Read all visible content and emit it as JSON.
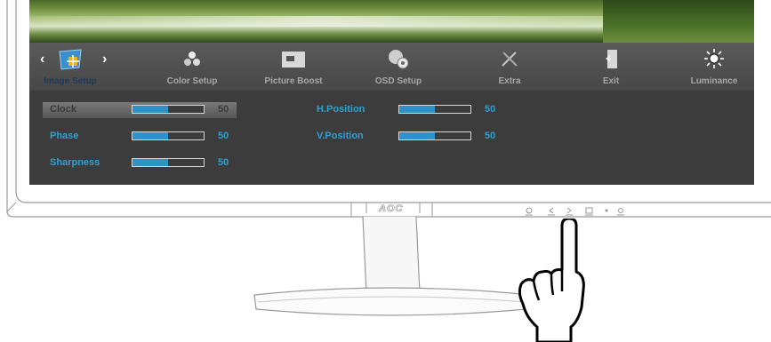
{
  "brand": "AOC",
  "menu": [
    {
      "label": "Image Setup",
      "icon": "image-setup-icon",
      "active": true
    },
    {
      "label": "Color Setup",
      "icon": "color-setup-icon",
      "active": false
    },
    {
      "label": "Picture Boost",
      "icon": "picture-boost-icon",
      "active": false
    },
    {
      "label": "OSD Setup",
      "icon": "osd-setup-icon",
      "active": false
    },
    {
      "label": "Extra",
      "icon": "extra-icon",
      "active": false
    },
    {
      "label": "Exit",
      "icon": "exit-icon",
      "active": false
    },
    {
      "label": "Luminance",
      "icon": "luminance-icon",
      "active": false
    }
  ],
  "settings_left": [
    {
      "name": "Clock",
      "value": "50",
      "level": 0.5,
      "selected": true
    },
    {
      "name": "Phase",
      "value": "50",
      "level": 0.5,
      "selected": false
    },
    {
      "name": "Sharpness",
      "value": "50",
      "level": 0.5,
      "selected": false
    }
  ],
  "settings_right": [
    {
      "name": "H.Position",
      "value": "50",
      "level": 0.5
    },
    {
      "name": "V.Position",
      "value": "50",
      "level": 0.5
    }
  ],
  "front_buttons": [
    "power-icon",
    "chevron-left-icon",
    "chevron-right-icon",
    "menu-icon",
    "dot-icon",
    "source-icon"
  ],
  "colors": {
    "accent": "#2fa0d2",
    "bar_fill": "#2c93c8",
    "osd_bg": "#3c3c3c"
  }
}
